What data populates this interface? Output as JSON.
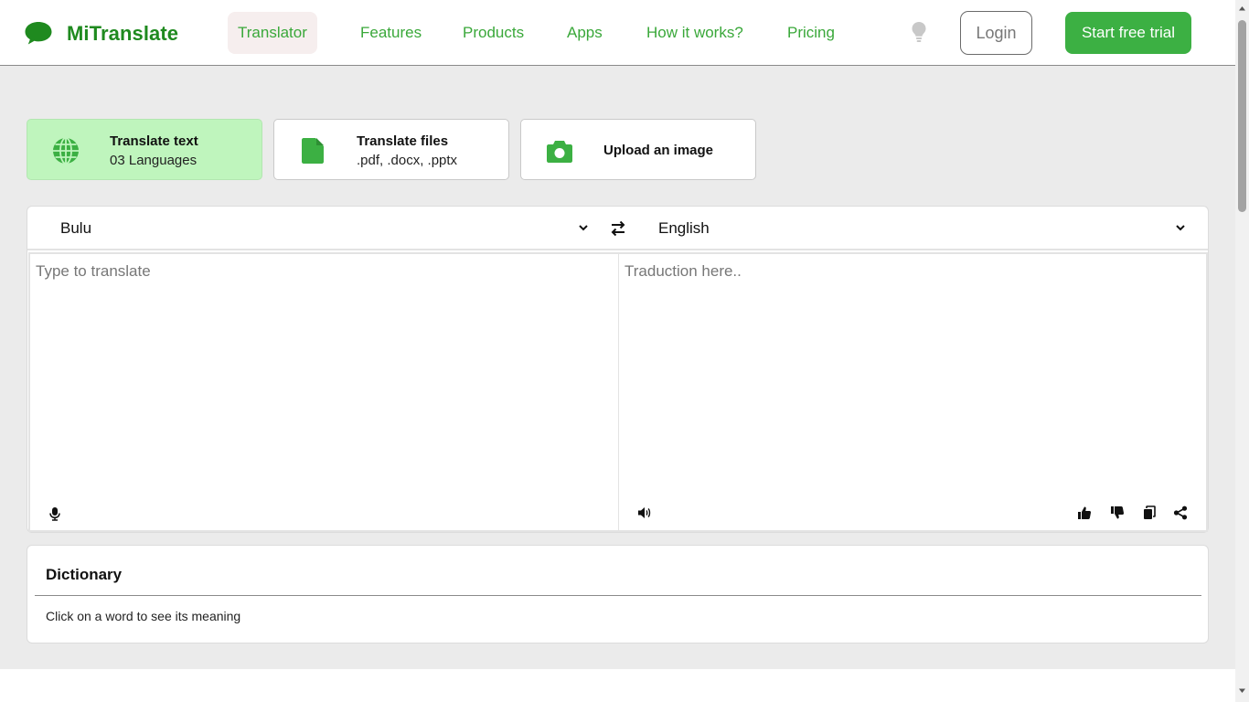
{
  "brand": {
    "name": "MiTranslate",
    "color": "#1f8a1f",
    "icon": "speech-bubble-icon"
  },
  "nav": {
    "items": [
      {
        "label": "Translator",
        "active": true
      },
      {
        "label": "Features"
      },
      {
        "label": "Products"
      },
      {
        "label": "Apps"
      },
      {
        "label": "How it works?"
      },
      {
        "label": "Pricing"
      }
    ],
    "theme_icon": "lightbulb-icon",
    "login_label": "Login",
    "trial_label": "Start free trial"
  },
  "modes": [
    {
      "title": "Translate text",
      "subtitle": "03 Languages",
      "icon": "globe-icon",
      "active": true
    },
    {
      "title": "Translate files",
      "subtitle": ".pdf, .docx, .pptx",
      "icon": "file-icon"
    },
    {
      "title": "Upload an image",
      "subtitle": "",
      "icon": "camera-icon"
    }
  ],
  "translator": {
    "source_language": "Bulu",
    "target_language": "English",
    "source_placeholder": "Type to translate",
    "target_placeholder": "Traduction here..",
    "source_tools": [
      "microphone-icon"
    ],
    "target_tools": [
      "speaker-icon",
      "thumbs-up-icon",
      "thumbs-down-icon",
      "copy-icon",
      "share-icon"
    ]
  },
  "dictionary": {
    "title": "Dictionary",
    "hint": "Click on a word to see its meaning"
  },
  "colors": {
    "accent": "#3cb043",
    "active_card": "#bff5bd",
    "nav_text": "#3aa83a",
    "page_bg": "#ebebeb"
  }
}
